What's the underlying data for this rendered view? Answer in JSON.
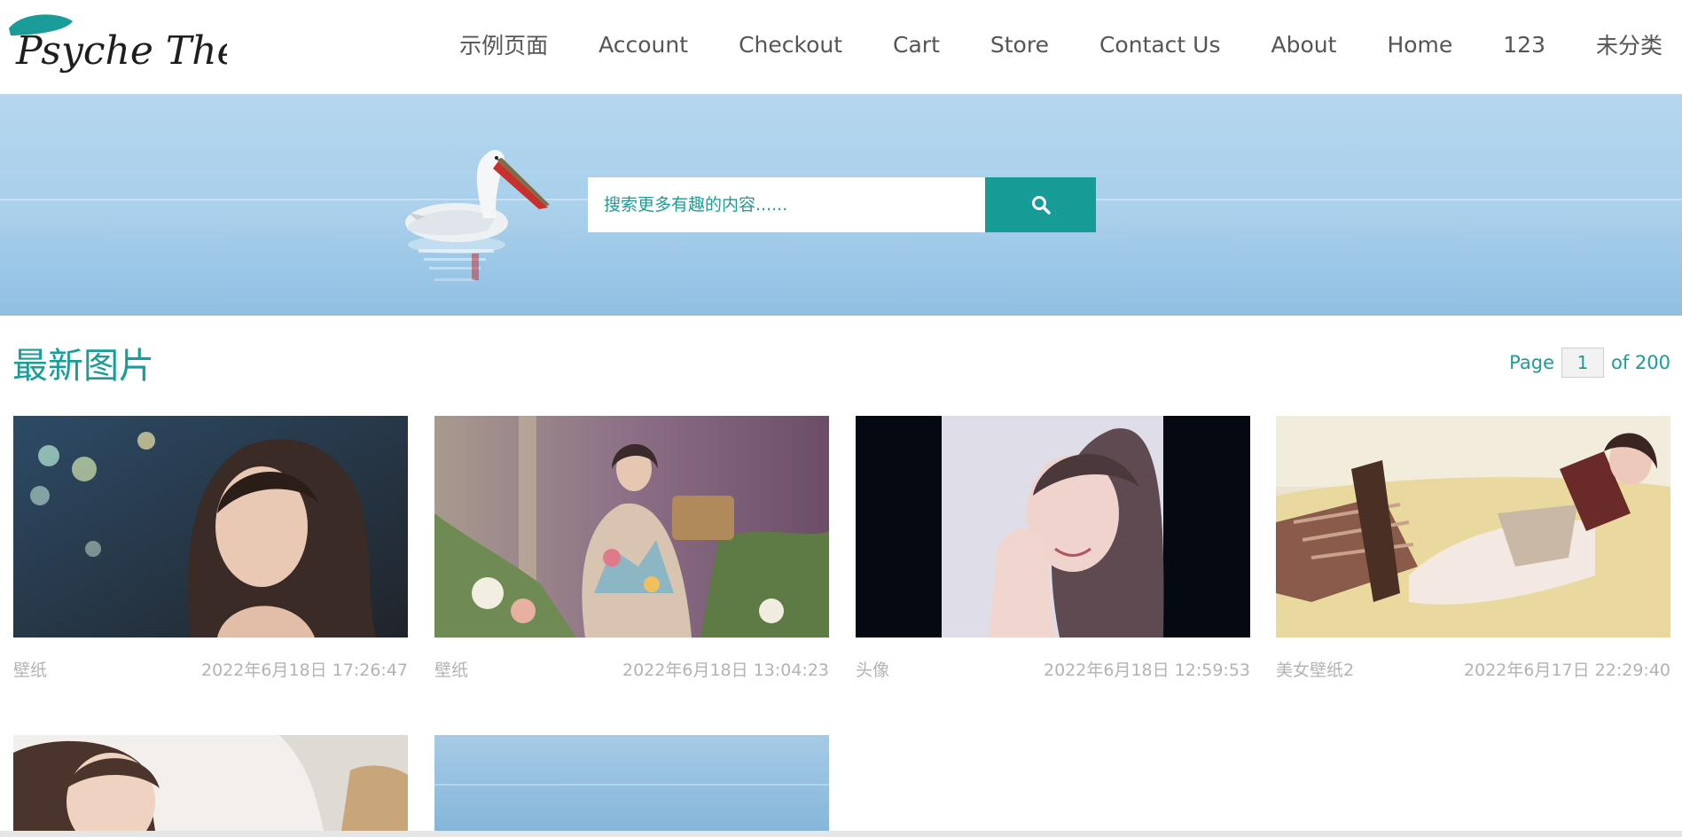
{
  "site": {
    "logo_text": "Psyche Theme"
  },
  "nav": {
    "items": [
      "示例页面",
      "Account",
      "Checkout",
      "Cart",
      "Store",
      "Contact Us",
      "About",
      "Home",
      "123",
      "未分类"
    ]
  },
  "search": {
    "placeholder": "搜索更多有趣的内容......",
    "button_icon": "search-icon"
  },
  "section": {
    "title": "最新图片"
  },
  "pager": {
    "prefix": "Page",
    "current": "1",
    "suffix": "of 200"
  },
  "cards": [
    {
      "category": "壁纸",
      "date": "2022年6月18日 17:26:47"
    },
    {
      "category": "壁纸",
      "date": "2022年6月18日 13:04:23"
    },
    {
      "category": "头像",
      "date": "2022年6月18日 12:59:53"
    },
    {
      "category": "美女壁纸2",
      "date": "2022年6月17日 22:29:40"
    },
    {
      "category": "",
      "date": ""
    },
    {
      "category": "",
      "date": ""
    }
  ],
  "colors": {
    "accent": "#179b96",
    "meta_text": "#b3b3b3",
    "nav_text": "#555555"
  }
}
